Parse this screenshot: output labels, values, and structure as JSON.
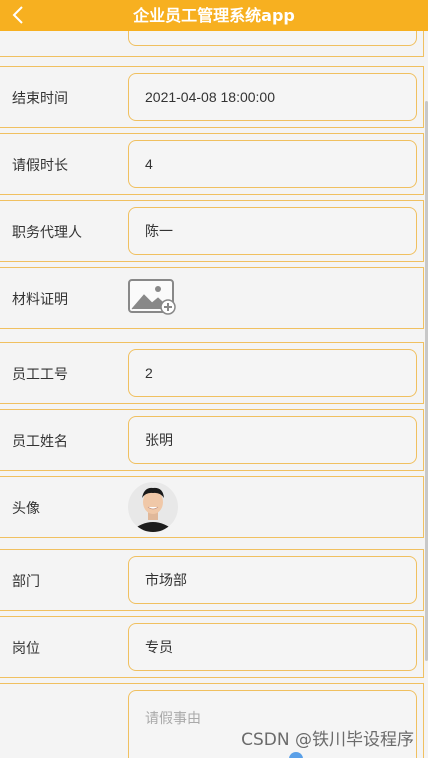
{
  "header": {
    "title": "企业员工管理系统app"
  },
  "rows": [
    {
      "label": "结束时间",
      "value": "2021-04-08 18:00:00"
    },
    {
      "label": "请假时长",
      "value": "4"
    },
    {
      "label": "职务代理人",
      "value": "陈一"
    },
    {
      "label": "材料证明"
    },
    {
      "label": "员工工号",
      "value": "2"
    },
    {
      "label": "员工姓名",
      "value": "张明"
    },
    {
      "label": "头像"
    },
    {
      "label": "部门",
      "value": "市场部"
    },
    {
      "label": "岗位",
      "value": "专员"
    }
  ],
  "reason": {
    "placeholder": "请假事由"
  },
  "watermark": "CSDN @铁川毕设程序",
  "colors": {
    "accent": "#f7b020",
    "border": "#f0c060"
  }
}
